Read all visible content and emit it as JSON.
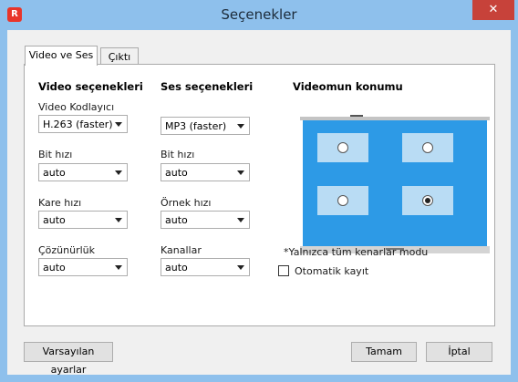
{
  "window": {
    "title": "Seçenekler",
    "icon": "app-logo-icon",
    "close_icon": "close-icon"
  },
  "tabs": [
    "Video ve Ses",
    "Çıktı"
  ],
  "video": {
    "heading": "Video seçenekleri",
    "codec_label": "Video Kodlayıcı",
    "codec_value": "H.263 (faster)",
    "bitrate_label": "Bit hızı",
    "bitrate_value": "auto",
    "framerate_label": "Kare hızı",
    "framerate_value": "auto",
    "resolution_label": "Çözünürlük",
    "resolution_value": "auto"
  },
  "audio": {
    "heading": "Ses seçenekleri",
    "codec_value": "MP3 (faster)",
    "bitrate_label": "Bit hızı",
    "bitrate_value": "auto",
    "samplerate_label": "Örnek hızı",
    "samplerate_value": "auto",
    "channels_label": "Kanallar",
    "channels_value": "auto"
  },
  "position": {
    "heading": "Videomun konumu",
    "note": "*Yalnızca tüm kenarlar modu",
    "autosave_label": "Otomatik kayıt",
    "autosave_checked": false,
    "selected_corner": "bottom-right"
  },
  "buttons": {
    "defaults": "Varsayılan ayarlar",
    "ok": "Tamam",
    "cancel": "İptal"
  },
  "colors": {
    "screen": "#2d9ae6",
    "accent": "#e8352a"
  }
}
